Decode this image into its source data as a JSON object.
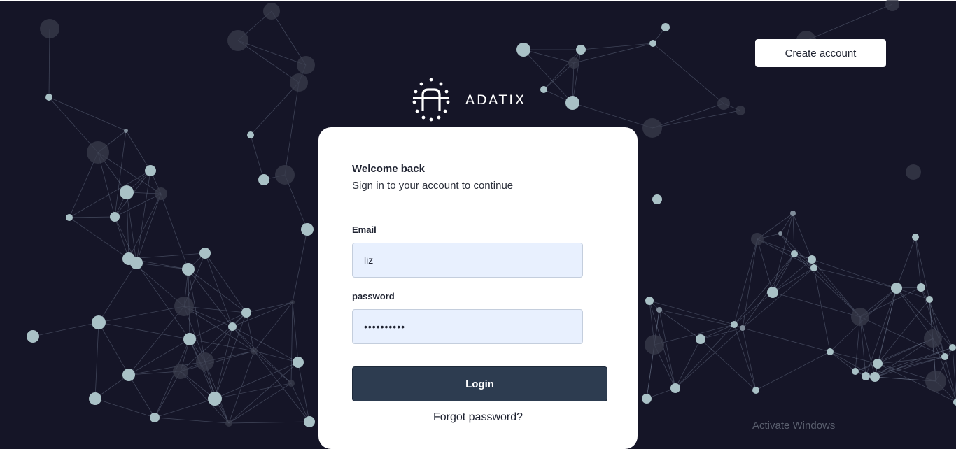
{
  "header": {
    "create_account_label": "Create account"
  },
  "brand": {
    "name": "ADATIX"
  },
  "login_card": {
    "title": "Welcome back",
    "subtitle": "Sign in to your account to continue",
    "email_label": "Email",
    "email_value": "liz",
    "password_label": "password",
    "password_value": "••••••••••",
    "login_label": "Login",
    "forgot_label": "Forgot password?"
  },
  "watermark": {
    "text": "Activate Windows"
  },
  "colors": {
    "background": "#151527",
    "node": "#a9c1c6",
    "button_dark": "#2d3c50",
    "input_bg": "#e8f0fe"
  }
}
